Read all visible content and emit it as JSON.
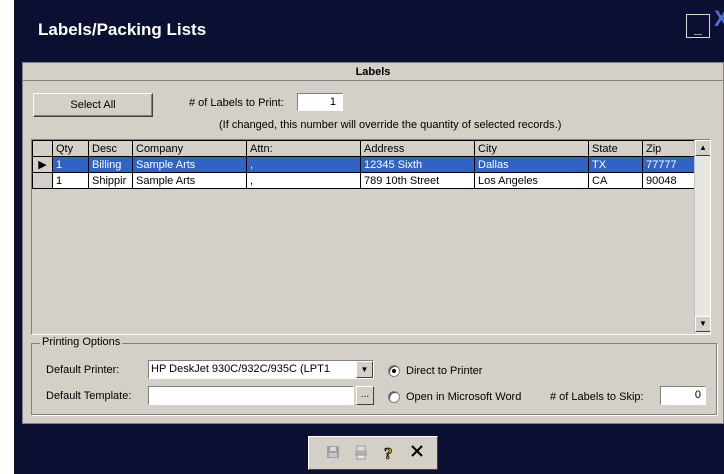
{
  "window": {
    "title": "Labels/Packing Lists",
    "minimize_label": "_",
    "close_label": "X"
  },
  "panel": {
    "header": "Labels"
  },
  "controls": {
    "select_all_label": "Select All",
    "labels_to_print_label": "# of Labels to Print:",
    "labels_to_print_value": "1",
    "hint": "(If changed, this number will override the quantity of selected records.)"
  },
  "table": {
    "columns": [
      "Qty",
      "Desc",
      "Company",
      "Attn:",
      "Address",
      "City",
      "State",
      "Zip"
    ],
    "rows": [
      {
        "selected": true,
        "indicator": "▶",
        "cells": [
          "1",
          "Billing",
          "Sample Arts",
          ",",
          "12345 Sixth",
          "Dallas",
          "TX",
          "77777"
        ]
      },
      {
        "selected": false,
        "indicator": "",
        "cells": [
          "1",
          "Shippir",
          "Sample Arts",
          ",",
          "789 10th Street",
          "Los Angeles",
          "CA",
          "90048"
        ]
      }
    ]
  },
  "printing_options": {
    "legend": "Printing Options",
    "default_printer_label": "Default Printer:",
    "default_printer_value": "HP DeskJet 930C/932C/935C (LPT1",
    "default_template_label": "Default Template:",
    "default_template_value": "",
    "browse_label": "...",
    "direct_label": "Direct to Printer",
    "word_label": "Open in Microsoft Word",
    "selected_output": "direct",
    "skip_label": "# of Labels to Skip:",
    "skip_value": "0"
  },
  "toolbar": {
    "icons": [
      "save-icon",
      "print-icon",
      "help-icon",
      "close-icon"
    ]
  },
  "colors": {
    "frame": "#0b1033",
    "panel": "#d4d0c8",
    "selection": "#3163c5"
  }
}
